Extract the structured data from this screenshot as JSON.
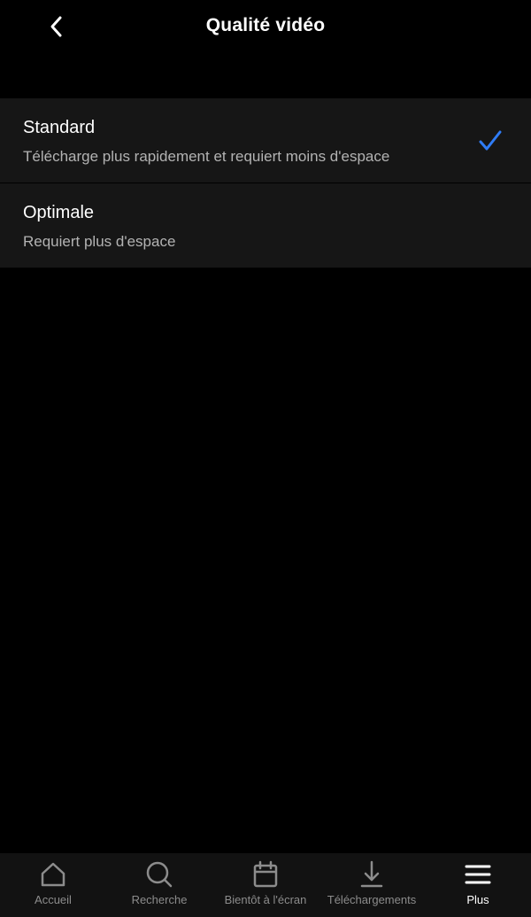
{
  "header": {
    "title": "Qualité vidéo",
    "back_icon": "chevron-left-icon"
  },
  "options": [
    {
      "title": "Standard",
      "description": "Télécharge plus rapidement et requiert moins d'espace",
      "selected": true
    },
    {
      "title": "Optimale",
      "description": "Requiert plus d'espace",
      "selected": false
    }
  ],
  "colors": {
    "background": "#000000",
    "row_background": "#161616",
    "check": "#2f7cf6",
    "secondary_text": "#b3b3b3",
    "nav_inactive": "#8c8c8c",
    "nav_active": "#ffffff"
  },
  "bottom_nav": {
    "items": [
      {
        "label": "Accueil",
        "icon": "home-icon",
        "active": false
      },
      {
        "label": "Recherche",
        "icon": "search-icon",
        "active": false
      },
      {
        "label": "Bientôt à l'écran",
        "icon": "calendar-icon",
        "active": false
      },
      {
        "label": "Téléchargements",
        "icon": "download-icon",
        "active": false
      },
      {
        "label": "Plus",
        "icon": "menu-icon",
        "active": true
      }
    ]
  }
}
